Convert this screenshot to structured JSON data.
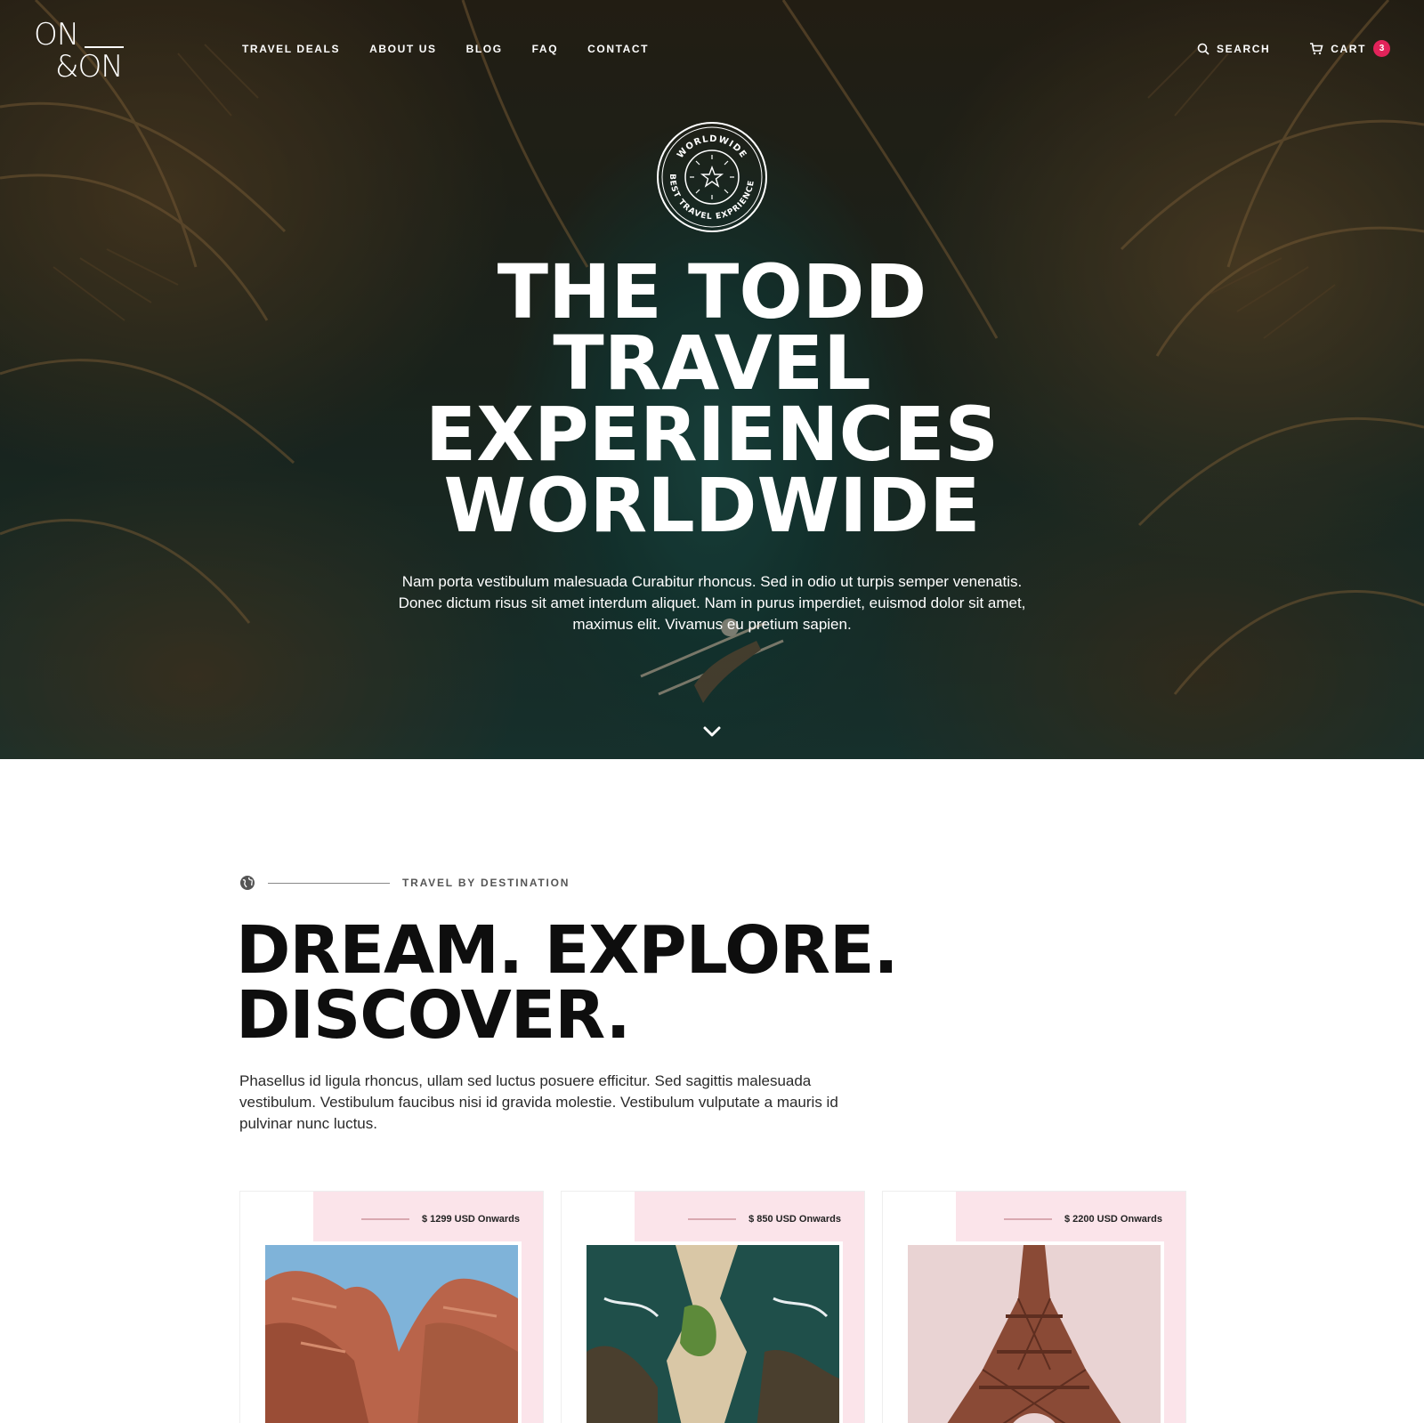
{
  "brand": {
    "logo_line1": "ON",
    "logo_line2": "&ON"
  },
  "nav": {
    "items": [
      {
        "label": "TRAVEL DEALS"
      },
      {
        "label": "ABOUT US"
      },
      {
        "label": "BLOG"
      },
      {
        "label": "FAQ"
      },
      {
        "label": "CONTACT"
      }
    ]
  },
  "header": {
    "search_label": "SEARCH",
    "cart_label": "CART",
    "cart_count": "3"
  },
  "hero": {
    "seal_top": "WORLDWIDE",
    "seal_bottom": "BEST TRAVEL EXPRIENCES",
    "title_lines": [
      "THE TODD",
      "TRAVEL",
      "EXPERIENCES",
      "WORLDWIDE"
    ],
    "text": "Nam porta vestibulum malesuada Curabitur rhoncus. Sed in odio ut turpis semper venenatis. Donec dictum risus sit amet interdum aliquet. Nam in purus imperdiet, euismod dolor sit amet, maximus elit. Vivamus eu pretium sapien."
  },
  "section": {
    "eyebrow": "TRAVEL BY DESTINATION",
    "title_lines": [
      "DREAM. EXPLORE.",
      "DISCOVER."
    ],
    "text": "Phasellus id ligula rhoncus, ullam sed luctus posuere efficitur. Sed sagittis malesuada vestibulum. Vestibulum faucibus nisi id gravida molestie. Vestibulum vulputate a mauris id pulvinar nunc luctus."
  },
  "cards": [
    {
      "price": "$ 1299 USD Onwards"
    },
    {
      "price": "$ 850 USD Onwards"
    },
    {
      "price": "$ 2200 USD Onwards"
    }
  ],
  "colors": {
    "accent": "#e2235a",
    "card_pink": "#fbe4ea",
    "dark_text": "#0e0e0e"
  }
}
